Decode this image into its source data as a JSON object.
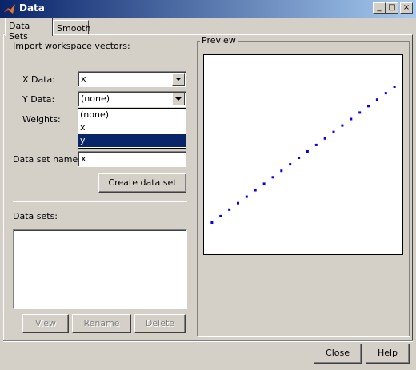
{
  "window": {
    "title": "Data",
    "minimize_glyph": "_",
    "maximize_glyph": "□",
    "close_glyph": "×"
  },
  "tabs": [
    {
      "label": "Data Sets",
      "active": true
    },
    {
      "label": "Smooth",
      "active": false
    }
  ],
  "import": {
    "heading": "Import workspace vectors:",
    "x_label": "X Data:",
    "x_value": "x",
    "y_label": "Y Data:",
    "y_value": "(none)",
    "weights_label": "Weights:",
    "y_options": [
      "(none)",
      "x",
      "y"
    ],
    "y_highlighted_option": "y",
    "dataset_name_label": "Data set name:",
    "dataset_name_value": "x",
    "create_button": "Create data set"
  },
  "datasets": {
    "label": "Data sets:",
    "items": [],
    "view_button": "View",
    "rename_button": "Rename",
    "delete_button": "Delete"
  },
  "preview": {
    "title": "Preview",
    "marker_color": "#0000ff",
    "chart_data": {
      "type": "scatter",
      "title": "",
      "xlabel": "",
      "ylabel": "",
      "x": [
        1,
        2,
        3,
        4,
        5,
        6,
        7,
        8,
        9,
        10,
        11,
        12,
        13,
        14,
        15,
        16,
        17,
        18,
        19,
        20,
        21,
        22
      ],
      "y": [
        1,
        2,
        3,
        4,
        5,
        6,
        7,
        8,
        9,
        10,
        11,
        12,
        13,
        14,
        15,
        16,
        17,
        18,
        19,
        20,
        21,
        22
      ],
      "xlim": [
        0,
        23
      ],
      "ylim": [
        -4,
        27
      ],
      "grid": false
    }
  },
  "footer": {
    "close_button": "Close",
    "help_button": "Help"
  }
}
